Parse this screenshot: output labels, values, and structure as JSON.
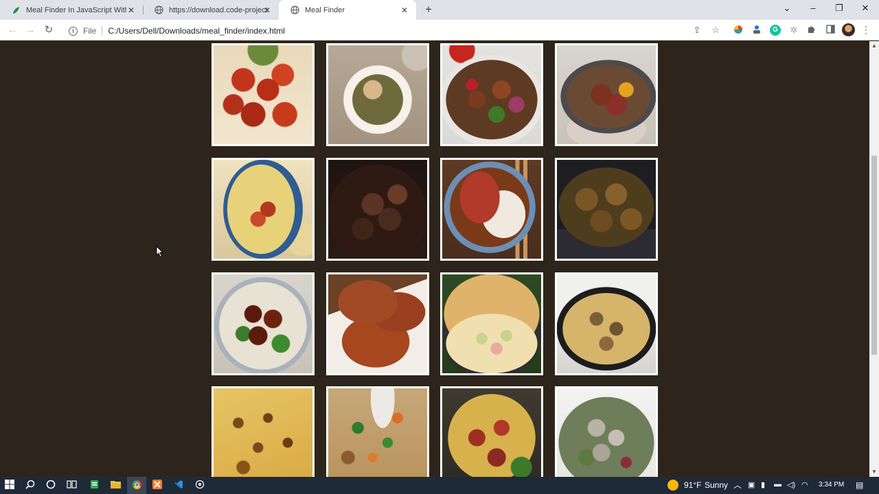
{
  "browser": {
    "tabs": [
      {
        "title": "Meal Finder In JavaScript With So",
        "icon": "leaf-icon",
        "active": false
      },
      {
        "title": "https://download.code-projects.o",
        "icon": "globe-icon",
        "active": false
      },
      {
        "title": "Meal Finder",
        "icon": "globe-icon",
        "active": true
      }
    ],
    "address": {
      "scheme_label": "File",
      "url": "C:/Users/Dell/Downloads/meal_finder/index.html"
    },
    "extensions": [
      "share-icon",
      "star-icon",
      "color-wheel-icon",
      "person-icon",
      "grammarly-icon",
      "openai-icon",
      "puzzle-icon",
      "sidepanel-icon"
    ],
    "new_tab_glyph": "+"
  },
  "page": {
    "background": "#2d251b",
    "meals": [
      {
        "name": "meal-tandoori-chicken"
      },
      {
        "name": "meal-chicken-rice-bowl"
      },
      {
        "name": "meal-chicken-stirfry"
      },
      {
        "name": "meal-chicken-casserole-pan"
      },
      {
        "name": "meal-potato-bake"
      },
      {
        "name": "meal-braised-chicken"
      },
      {
        "name": "meal-katsu-curry"
      },
      {
        "name": "meal-chicken-skillet"
      },
      {
        "name": "meal-teriyaki-chicken"
      },
      {
        "name": "meal-fried-chicken"
      },
      {
        "name": "meal-chicken-ham-pie"
      },
      {
        "name": "meal-chicken-pasta-skillet"
      },
      {
        "name": "meal-gratin-potatoes"
      },
      {
        "name": "meal-fried-rice"
      },
      {
        "name": "meal-chicken-bake-dish"
      },
      {
        "name": "meal-chicken-salad"
      }
    ]
  },
  "taskbar": {
    "weather": {
      "temp": "91°F",
      "condition": "Sunny"
    },
    "time": "3:34 PM"
  }
}
